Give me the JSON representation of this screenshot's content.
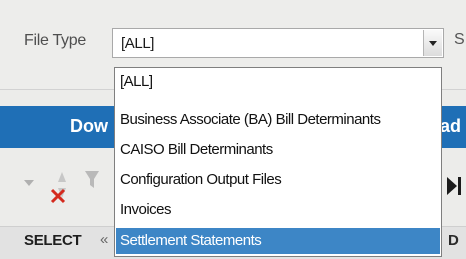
{
  "filter": {
    "label": "File Type",
    "selected_value": "[ALL]",
    "right_label_fragment": "S"
  },
  "dropdown": {
    "options": [
      "[ALL]",
      "Business Associate (BA) Bill Determinants",
      "CAISO Bill Determinants",
      "Configuration Output Files",
      "Invoices",
      "Settlement Statements"
    ],
    "highlighted": "Settlement Statements"
  },
  "banner": {
    "left_text": "Dow",
    "right_text": "ad"
  },
  "table": {
    "headers": [
      "SELECT",
      "«",
      "D"
    ]
  }
}
